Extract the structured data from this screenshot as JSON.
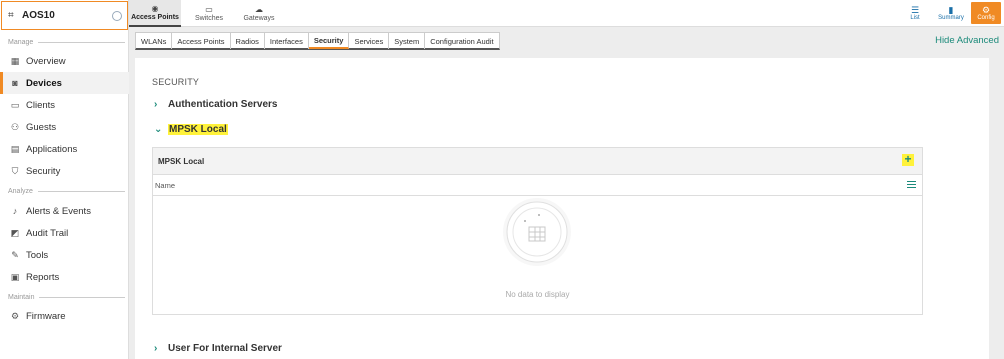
{
  "group": {
    "name": "AOS10"
  },
  "sidebar": {
    "sections": {
      "manage": "Manage",
      "analyze": "Analyze",
      "maintain": "Maintain"
    },
    "items": [
      {
        "label": "Overview",
        "icon": "grid-icon"
      },
      {
        "label": "Devices",
        "icon": "devices-icon"
      },
      {
        "label": "Clients",
        "icon": "clients-icon"
      },
      {
        "label": "Guests",
        "icon": "guests-icon"
      },
      {
        "label": "Applications",
        "icon": "applications-icon"
      },
      {
        "label": "Security",
        "icon": "shield-icon"
      },
      {
        "label": "Alerts & Events",
        "icon": "bell-icon"
      },
      {
        "label": "Audit Trail",
        "icon": "audit-icon"
      },
      {
        "label": "Tools",
        "icon": "wrench-icon"
      },
      {
        "label": "Reports",
        "icon": "reports-icon"
      },
      {
        "label": "Firmware",
        "icon": "gear-icon"
      }
    ]
  },
  "device_tabs": [
    {
      "label": "Access Points",
      "icon": "access-point-icon"
    },
    {
      "label": "Switches",
      "icon": "switch-icon"
    },
    {
      "label": "Gateways",
      "icon": "gateway-icon"
    }
  ],
  "view_tabs": [
    {
      "label": "List",
      "icon": "list-icon"
    },
    {
      "label": "Summary",
      "icon": "bar-chart-icon"
    },
    {
      "label": "Config",
      "icon": "gear-icon"
    }
  ],
  "sub_tabs": [
    "WLANs",
    "Access Points",
    "Radios",
    "Interfaces",
    "Security",
    "Services",
    "System",
    "Configuration Audit"
  ],
  "hide_advanced": "Hide Advanced",
  "content": {
    "section_title": "SECURITY",
    "accordions": [
      {
        "label": "Authentication Servers",
        "expanded": false
      },
      {
        "label": "MPSK Local",
        "expanded": true
      },
      {
        "label": "User For Internal Server",
        "expanded": false
      }
    ],
    "table": {
      "title": "MPSK Local",
      "add_symbol": "+",
      "columns": [
        "Name"
      ],
      "empty_text": "No data to display"
    }
  },
  "colors": {
    "accent": "#f08a24",
    "teal": "#1b8a7a",
    "highlight": "#fff23a"
  }
}
